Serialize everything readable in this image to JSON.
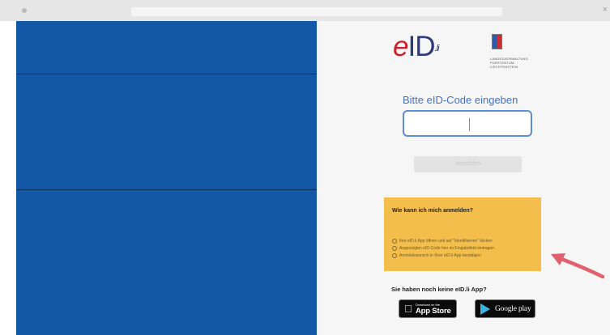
{
  "window": {
    "close_glyph": "×"
  },
  "logo": {
    "brand_e": "e",
    "brand_id": "ID",
    "brand_suffix": ".li"
  },
  "crest_caption": "LANDESVERWALTUNG FÜRSTENTUM LIECHTENSTEIN",
  "login": {
    "prompt": "Bitte eID-Code eingeben",
    "input_value": "",
    "button_label": "Anmelden"
  },
  "help_box": {
    "title": "Wie kann ich mich anmelden?",
    "steps": [
      "Ihre eID.li App öffnen und auf \"Identifizieren\" klicken",
      "Angezeigten eID-Code hier im Eingabefeld eintragen",
      "Anmeldewunsch in Ihrer eID.li App bestätigen"
    ]
  },
  "no_app_text": "Sie haben noch keine eID.li App?",
  "app_store": {
    "small": "Download on the",
    "big": "App Store",
    "icon": "apple-icon"
  },
  "google_play": {
    "big": "Google play",
    "icon": "play-icon"
  },
  "colors": {
    "left_panel": "#1358a6",
    "brand_red": "#cc1f2a",
    "brand_blue": "#2c3a7e",
    "help_box": "#f4be4d",
    "arrow": "#e0606e"
  }
}
